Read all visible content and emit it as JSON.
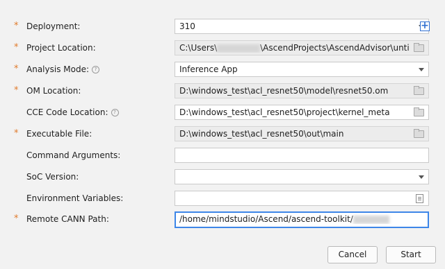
{
  "form": {
    "deployment": {
      "label": "Deployment:",
      "value": "310",
      "required": true
    },
    "project_location": {
      "label": "Project Location:",
      "value_prefix": "C:\\Users\\",
      "value_suffix": "\\AscendProjects\\AscendAdvisor\\untitled",
      "required": true
    },
    "analysis_mode": {
      "label": "Analysis Mode:",
      "value": "Inference App",
      "required": true
    },
    "om_location": {
      "label": "OM Location:",
      "value": "D:\\windows_test\\acl_resnet50\\model\\resnet50.om",
      "required": true
    },
    "cce_code_location": {
      "label": "CCE Code Location:",
      "value": "D:\\windows_test\\acl_resnet50\\project\\kernel_meta",
      "required": false
    },
    "executable_file": {
      "label": "Executable File:",
      "value": "D:\\windows_test\\acl_resnet50\\out\\main",
      "required": true
    },
    "command_arguments": {
      "label": "Command Arguments:",
      "value": "",
      "required": false
    },
    "soc_version": {
      "label": "SoC Version:",
      "value": "",
      "required": false
    },
    "environment_variables": {
      "label": "Environment Variables:",
      "value": "",
      "required": false
    },
    "remote_cann_path": {
      "label": "Remote CANN Path:",
      "value_prefix": "/home/mindstudio/Ascend/ascend-toolkit/",
      "required": true
    }
  },
  "required_mark": "*",
  "help_glyph": "?",
  "add_glyph": "+",
  "buttons": {
    "cancel": "Cancel",
    "start": "Start"
  },
  "colors": {
    "required_star": "#e07b2c",
    "focus_border": "#3d86e8",
    "add_icon": "#2f6fd1"
  }
}
